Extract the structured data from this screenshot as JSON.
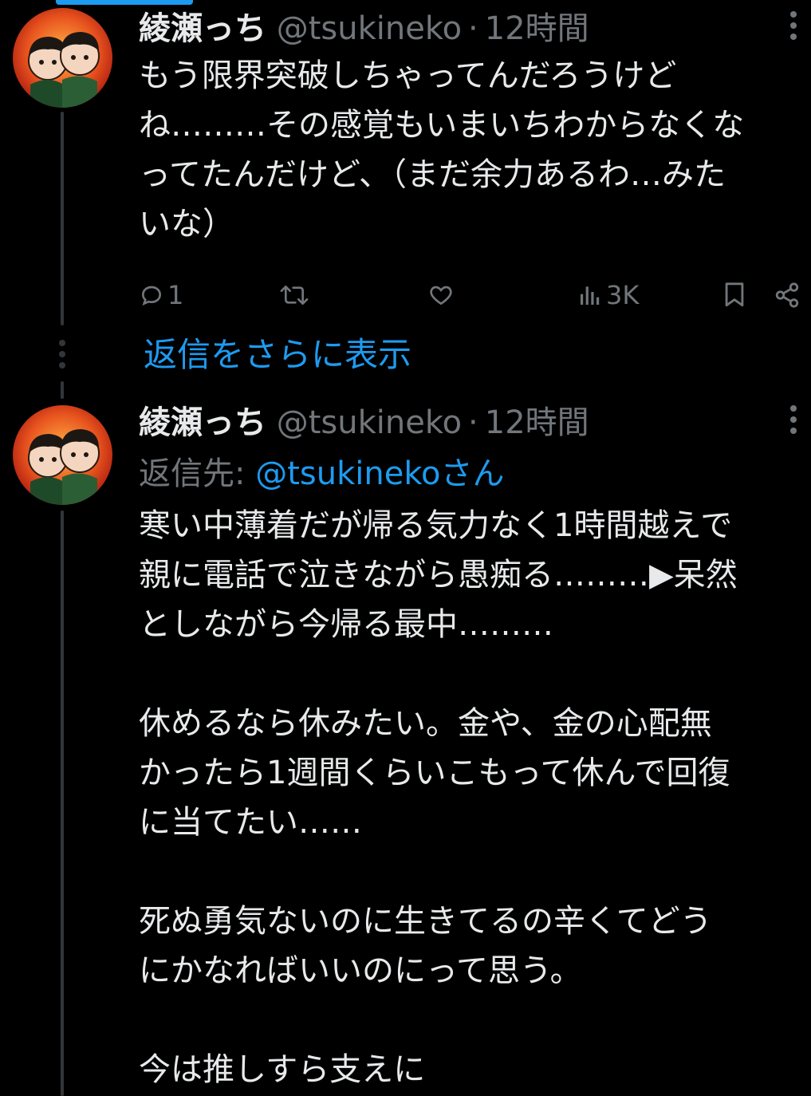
{
  "theme": {
    "accent": "#1d9bf0",
    "background": "#000000",
    "text_primary": "#e7e9ea",
    "text_secondary": "#71767b",
    "thread_line": "#333639"
  },
  "tweets": [
    {
      "author_name": "綾瀬っち",
      "author_handle": "@tsukineko",
      "separator": "·",
      "time": "12時間",
      "text": "もう限界突破しちゃってんだろうけど\nね………その感覚もいまいちわからなくな\nってたんだけど、（まだ余力あるわ…みた\nいな）",
      "actions": {
        "reply_icon": "reply-icon",
        "reply_count": "1",
        "retweet_icon": "retweet-icon",
        "like_icon": "heart-icon",
        "views_icon": "views-icon",
        "views_count": "3K",
        "bookmark_icon": "bookmark-icon",
        "share_icon": "share-icon"
      }
    },
    {
      "author_name": "綾瀬っち",
      "author_handle": "@tsukineko",
      "separator": "·",
      "time": "12時間",
      "reply_to_prefix": "返信先: ",
      "reply_to_handle": "@tsukinekoさん",
      "text": "寒い中薄着だが帰る気力なく1時間越えで\n親に電話で泣きながら愚痴る………▶呆然\nとしながら今帰る最中………\n\n休めるなら休みたい。金や、金の心配無\nかったら1週間くらいこもって休んで回復\nに当てたい……\n\n死ぬ勇気ないのに生きてるの辛くてどう\nにかなればいいのにって思う。\n\n今は推しすら支えに"
    }
  ],
  "show_more_replies": "返信をさらに表示"
}
